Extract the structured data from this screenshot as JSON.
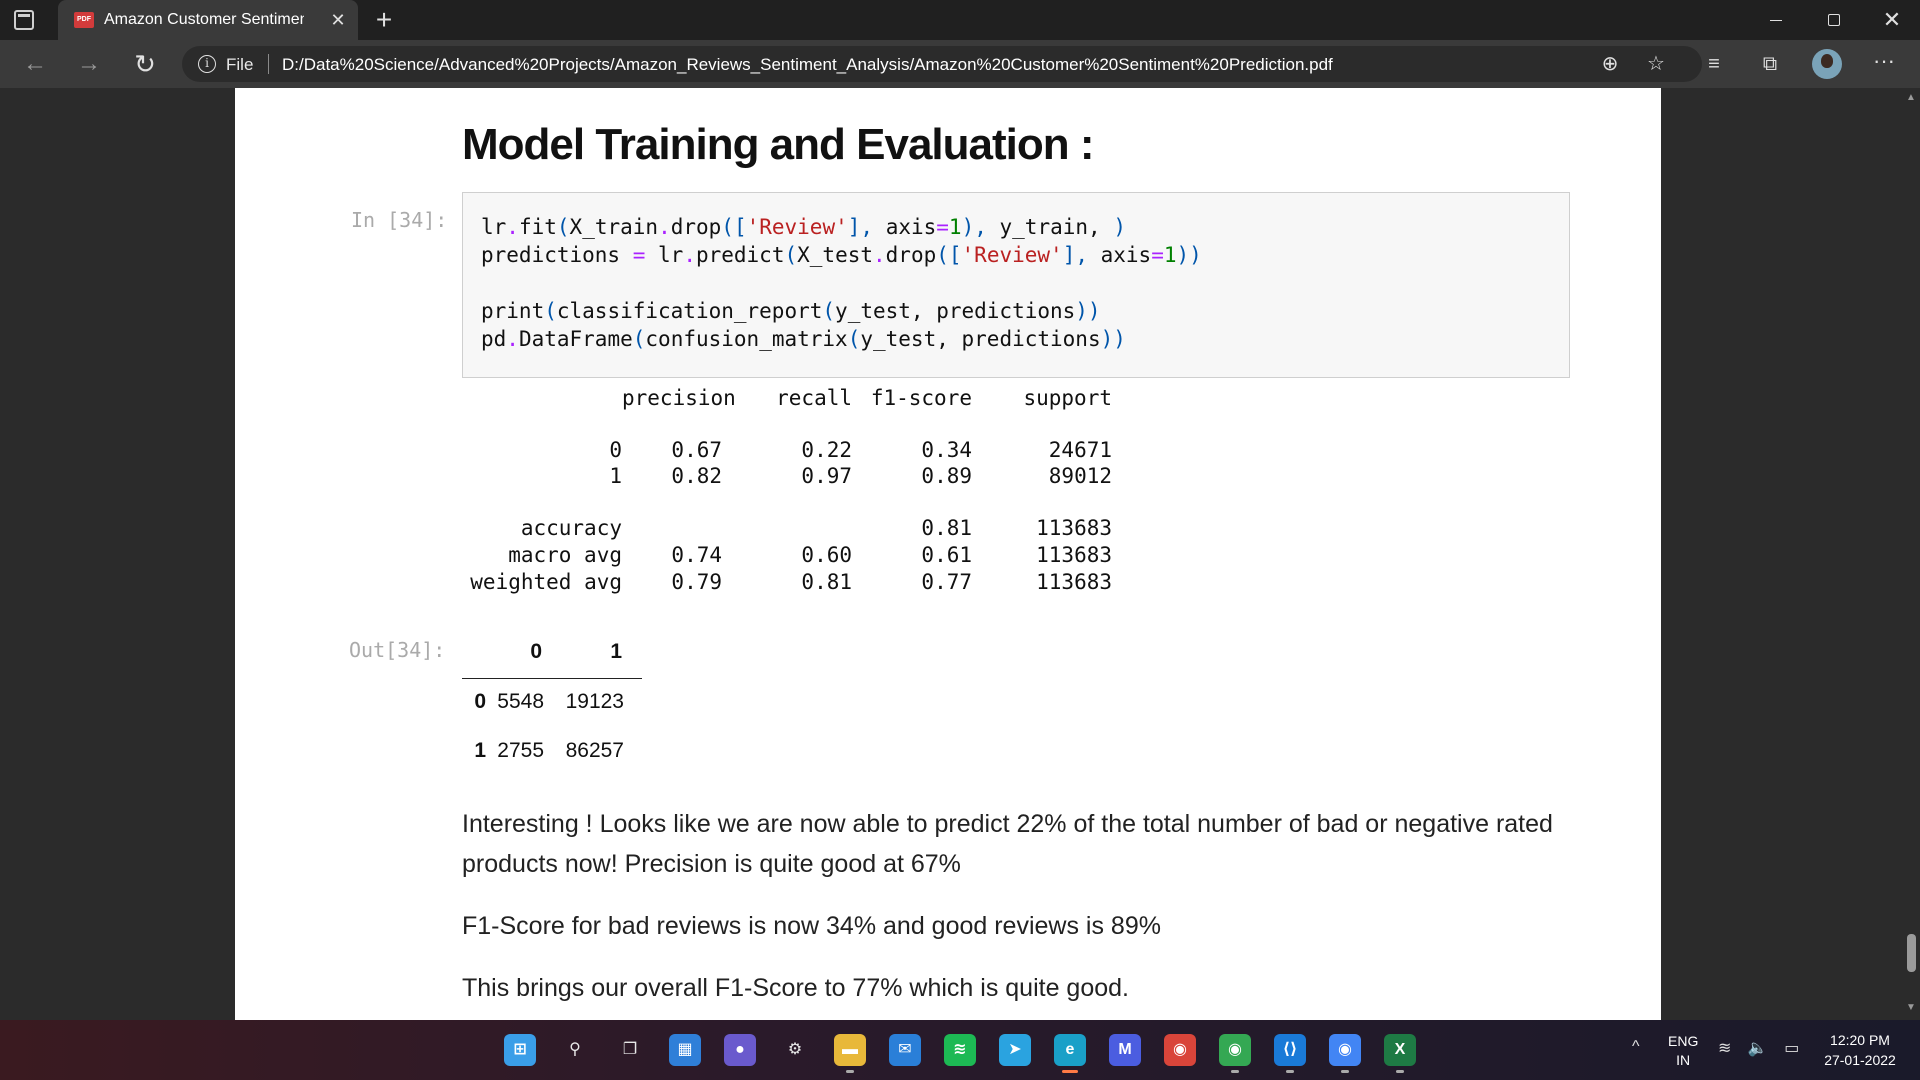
{
  "browser": {
    "tab_title": "Amazon Customer Sentiment Pre",
    "tab_close": "✕",
    "new_tab": "+",
    "file_label": "File",
    "url": "D:/Data%20Science/Advanced%20Projects/Amazon_Reviews_Sentiment_Analysis/Amazon%20Customer%20Sentiment%20Prediction.pdf",
    "icons": [
      "tab-actions-icon",
      "pdf-icon",
      "back-icon",
      "forward-icon",
      "refresh-icon",
      "info-icon",
      "zoom-icon",
      "add-favorite-icon",
      "favorites-icon",
      "collections-icon",
      "more-icon"
    ]
  },
  "notebook": {
    "heading": "Model Training and Evaluation :",
    "in_prompt": "In [34]:",
    "out_prompt": "Out[34]:",
    "code": {
      "line1_a": "lr",
      "line1_b": ".",
      "line1_c": "fit",
      "line1_d": "(",
      "line1_e": "X_train",
      "line1_f": ".",
      "line1_g": "drop",
      "line1_h": "([",
      "line1_i": "'Review'",
      "line1_j": "],",
      "line1_k": " axis",
      "line1_l": "=",
      "line1_m": "1",
      "line1_n": "),",
      "line1_o": " y_train,",
      "line1_p": " )",
      "line2_a": "predictions ",
      "line2_b": "=",
      "line2_c": " lr",
      "line2_d": ".",
      "line2_e": "predict",
      "line2_f": "(",
      "line2_g": "X_test",
      "line2_h": ".",
      "line2_i": "drop",
      "line2_j": "([",
      "line2_k": "'Review'",
      "line2_l": "],",
      "line2_m": " axis",
      "line2_n": "=",
      "line2_o": "1",
      "line2_p": "))",
      "line3_a": "print",
      "line3_b": "(",
      "line3_c": "classification_report",
      "line3_d": "(",
      "line3_e": "y_test,",
      "line3_f": " predictions",
      "line3_g": "))",
      "line4_a": "pd",
      "line4_b": ".",
      "line4_c": "DataFrame",
      "line4_d": "(",
      "line4_e": "confusion_matrix",
      "line4_f": "(",
      "line4_g": "y_test,",
      "line4_h": " predictions",
      "line4_i": "))"
    },
    "report": {
      "headers": [
        "precision",
        "recall",
        "f1-score",
        "support"
      ],
      "rows": [
        {
          "label": "0",
          "precision": "0.67",
          "recall": "0.22",
          "f1": "0.34",
          "support": "24671"
        },
        {
          "label": "1",
          "precision": "0.82",
          "recall": "0.97",
          "f1": "0.89",
          "support": "89012"
        },
        {
          "label": "accuracy",
          "precision": "",
          "recall": "",
          "f1": "0.81",
          "support": "113683"
        },
        {
          "label": "macro avg",
          "precision": "0.74",
          "recall": "0.60",
          "f1": "0.61",
          "support": "113683"
        },
        {
          "label": "weighted avg",
          "precision": "0.79",
          "recall": "0.81",
          "f1": "0.77",
          "support": "113683"
        }
      ]
    },
    "confusion": {
      "col_headers": [
        "0",
        "1"
      ],
      "rows": [
        {
          "index": "0",
          "values": [
            "5548",
            "19123"
          ]
        },
        {
          "index": "1",
          "values": [
            "2755",
            "86257"
          ]
        }
      ]
    },
    "paragraphs": [
      "Interesting ! Looks like we are now able to predict 22% of the total number of bad or negative rated products now! Precision is quite good at 67%",
      "F1-Score for bad reviews is now 34% and good reviews is 89%",
      "This brings our overall F1-Score to 77% which is quite good."
    ]
  },
  "taskbar": {
    "apps": [
      {
        "name": "start-icon",
        "glyph": "⊞",
        "color": "#3a9ee8"
      },
      {
        "name": "search-icon",
        "glyph": "⚲",
        "color": "transparent"
      },
      {
        "name": "task-view-icon",
        "glyph": "❐",
        "color": "transparent"
      },
      {
        "name": "widgets-icon",
        "glyph": "▦",
        "color": "#2f7fd8"
      },
      {
        "name": "teams-chat-icon",
        "glyph": "●",
        "color": "#6a5acd"
      },
      {
        "name": "settings-icon",
        "glyph": "⚙",
        "color": "transparent"
      },
      {
        "name": "file-explorer-icon",
        "glyph": "▬",
        "color": "#e8b83a"
      },
      {
        "name": "mail-icon",
        "glyph": "✉",
        "color": "#2a7fd8"
      },
      {
        "name": "spotify-icon",
        "glyph": "≋",
        "color": "#1db954"
      },
      {
        "name": "telegram-icon",
        "glyph": "➤",
        "color": "#2aa3e0"
      },
      {
        "name": "edge-icon",
        "glyph": "e",
        "color": "#1aa0c8"
      },
      {
        "name": "editor-icon",
        "glyph": "M",
        "color": "#4b5de0"
      },
      {
        "name": "chrome-icon",
        "glyph": "◉",
        "color": "#d9453a"
      },
      {
        "name": "chrome-profile-icon",
        "glyph": "◉",
        "color": "#34a853"
      },
      {
        "name": "vscode-icon",
        "glyph": "⟨⟩",
        "color": "#1a7ad8"
      },
      {
        "name": "chrome-profile-2-icon",
        "glyph": "◉",
        "color": "#4285f4"
      },
      {
        "name": "excel-icon",
        "glyph": "X",
        "color": "#1e7a44"
      }
    ],
    "tray_chevron": "^",
    "lang_top": "ENG",
    "lang_bottom": "IN",
    "tray_icons": "≋ 🔈 ▭",
    "time": "12:20 PM",
    "date": "27-01-2022"
  }
}
